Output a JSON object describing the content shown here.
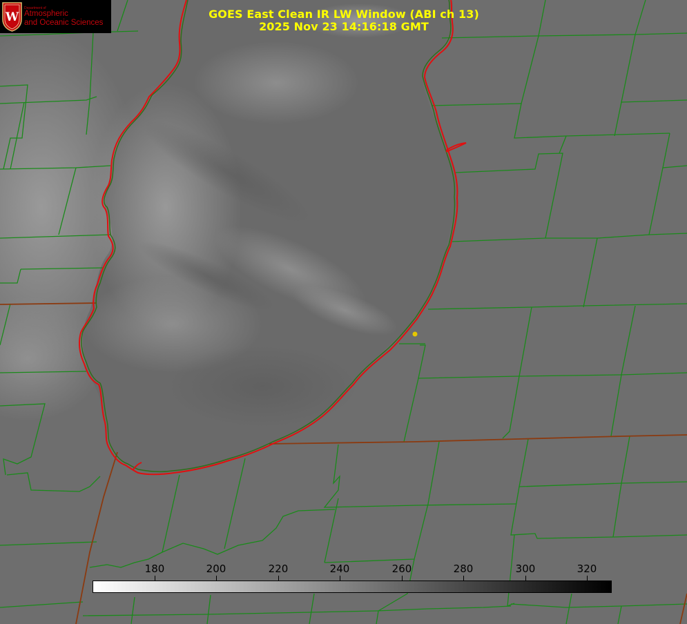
{
  "title": {
    "line1": "GOES East Clean IR LW Window (ABI ch 13)",
    "line2": "2025 Nov 23 14:16:18 GMT"
  },
  "logo": {
    "small_text": "Department of",
    "line1": "Atmospheric",
    "line2": "and Oceanic Sciences",
    "crest_letter": "W",
    "crest_icon": "uw-crest-icon"
  },
  "colors": {
    "title": "#ffff00",
    "lake_outline": "#e01010",
    "county_lines": "#1a8a1a",
    "state_lines": "#8b3a10",
    "marker": "#e6c800",
    "background": "#6b6b6b",
    "logo_text": "#c5050c"
  },
  "colorbar": {
    "min": 160,
    "max": 328,
    "ticks": [
      "180",
      "200",
      "220",
      "240",
      "260",
      "280",
      "300",
      "320"
    ],
    "tick_values": [
      180,
      200,
      220,
      240,
      260,
      280,
      300,
      320
    ],
    "gradient": "white-to-black"
  }
}
